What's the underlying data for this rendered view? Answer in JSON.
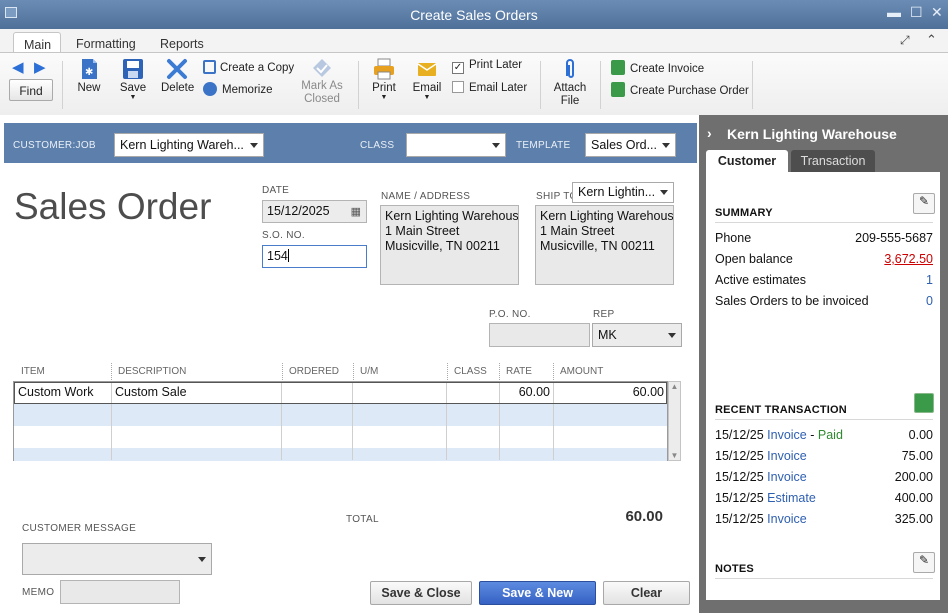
{
  "window": {
    "title": "Create Sales Orders"
  },
  "ribbon": {
    "tabs": [
      "Main",
      "Formatting",
      "Reports"
    ],
    "active_tab": "Main",
    "find": "Find",
    "new": "New",
    "save": "Save",
    "delete": "Delete",
    "create_copy": "Create a Copy",
    "memorize": "Memorize",
    "mark_as_closed_1": "Mark As",
    "mark_as_closed_2": "Closed",
    "print": "Print",
    "email": "Email",
    "print_later": "Print Later",
    "print_later_checked": true,
    "email_later": "Email Later",
    "email_later_checked": false,
    "attach_1": "Attach",
    "attach_2": "File",
    "create_invoice": "Create Invoice",
    "create_po": "Create Purchase Order"
  },
  "header": {
    "customer_job_label": "CUSTOMER:JOB",
    "customer_job_value": "Kern Lighting Wareh...",
    "class_label": "CLASS",
    "class_value": "",
    "template_label": "TEMPLATE",
    "template_value": "Sales Ord..."
  },
  "form": {
    "title": "Sales Order",
    "date_label": "DATE",
    "date_value": "15/12/2025",
    "so_label": "S.O. NO.",
    "so_value": "154",
    "name_address_label": "NAME / ADDRESS",
    "name_address": [
      "Kern Lighting Warehouse",
      "1 Main Street",
      "Musicville, TN 00211"
    ],
    "ship_to_label": "SHIP TO",
    "ship_to_select": "Kern Lightin...",
    "ship_to_address": [
      "Kern Lighting Warehouse",
      "1 Main Street",
      "Musicville, TN 00211"
    ],
    "po_label": "P.O. NO.",
    "po_value": "",
    "rep_label": "REP",
    "rep_value": "MK"
  },
  "grid": {
    "columns": [
      "ITEM",
      "DESCRIPTION",
      "ORDERED",
      "U/M",
      "CLASS",
      "RATE",
      "AMOUNT"
    ],
    "rows": [
      {
        "item": "Custom Work",
        "description": "Custom Sale",
        "ordered": "",
        "um": "",
        "class": "",
        "rate": "60.00",
        "amount": "60.00"
      }
    ]
  },
  "footer": {
    "customer_message_label": "CUSTOMER MESSAGE",
    "memo_label": "MEMO",
    "total_label": "TOTAL",
    "total_value": "60.00",
    "save_close": "Save & Close",
    "save_new": "Save & New",
    "clear": "Clear"
  },
  "panel": {
    "title": "Kern Lighting Warehouse",
    "tab_customer": "Customer",
    "tab_transaction": "Transaction",
    "summary_label": "SUMMARY",
    "phone_label": "Phone",
    "phone_value": "209-555-5687",
    "open_balance_label": "Open balance",
    "open_balance_value": "3,672.50",
    "active_estimates_label": "Active estimates",
    "active_estimates_value": "1",
    "so_invoiced_label": "Sales Orders to be invoiced",
    "so_invoiced_value": "0",
    "recent_label": "RECENT TRANSACTION",
    "recent": [
      {
        "date": "15/12/25",
        "type": "Invoice",
        "status": "Paid",
        "amount": "0.00"
      },
      {
        "date": "15/12/25",
        "type": "Invoice",
        "status": "",
        "amount": "75.00"
      },
      {
        "date": "15/12/25",
        "type": "Invoice",
        "status": "",
        "amount": "200.00"
      },
      {
        "date": "15/12/25",
        "type": "Estimate",
        "status": "",
        "amount": "400.00"
      },
      {
        "date": "15/12/25",
        "type": "Invoice",
        "status": "",
        "amount": "325.00"
      }
    ],
    "notes_label": "NOTES"
  },
  "colors": {
    "accent": "#5d7fab",
    "link": "#2e5fb0",
    "paid": "#2f8a2f",
    "balance": "#cc0000"
  }
}
